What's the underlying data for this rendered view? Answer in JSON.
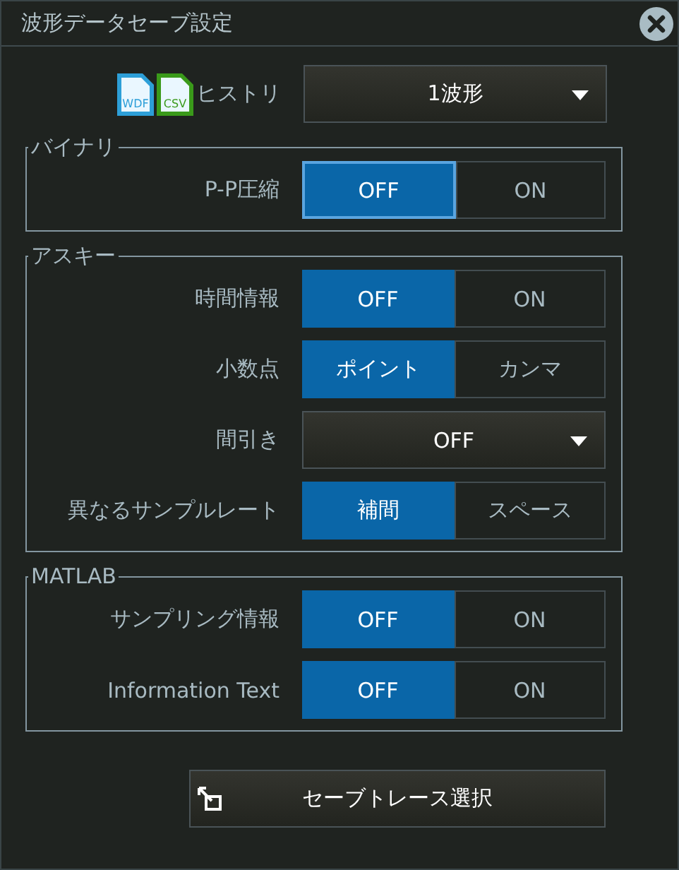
{
  "window": {
    "title": "波形データセーブ設定"
  },
  "history": {
    "file_icons": [
      {
        "text": "WDF",
        "color": "#2d9fd8"
      },
      {
        "text": "CSV",
        "color": "#3a9a1a"
      }
    ],
    "label": "ヒストリ",
    "dropdown": {
      "value": "1波形"
    }
  },
  "groups": [
    {
      "title": "バイナリ",
      "rows": [
        {
          "label": "P-P圧縮",
          "kind": "toggle",
          "options": [
            {
              "label": "OFF",
              "selected": true,
              "focused": true
            },
            {
              "label": "ON",
              "selected": false,
              "focused": false
            }
          ]
        }
      ]
    },
    {
      "title": "アスキー",
      "rows": [
        {
          "label": "時間情報",
          "kind": "toggle",
          "options": [
            {
              "label": "OFF",
              "selected": true,
              "focused": false
            },
            {
              "label": "ON",
              "selected": false,
              "focused": false
            }
          ]
        },
        {
          "label": "小数点",
          "kind": "toggle",
          "options": [
            {
              "label": "ポイント",
              "selected": true,
              "focused": false
            },
            {
              "label": "カンマ",
              "selected": false,
              "focused": false
            }
          ]
        },
        {
          "label": "間引き",
          "kind": "dropdown",
          "value": "OFF"
        },
        {
          "label": "異なるサンプルレート",
          "kind": "toggle",
          "options": [
            {
              "label": "補間",
              "selected": true,
              "focused": false
            },
            {
              "label": "スペース",
              "selected": false,
              "focused": false
            }
          ]
        }
      ]
    },
    {
      "title": "MATLAB",
      "rows": [
        {
          "label": "サンプリング情報",
          "kind": "toggle",
          "options": [
            {
              "label": "OFF",
              "selected": true,
              "focused": false
            },
            {
              "label": "ON",
              "selected": false,
              "focused": false
            }
          ]
        },
        {
          "label": "Information Text",
          "kind": "toggle",
          "options": [
            {
              "label": "OFF",
              "selected": true,
              "focused": false
            },
            {
              "label": "ON",
              "selected": false,
              "focused": false
            }
          ]
        }
      ]
    }
  ],
  "save_button": {
    "label": "セーブトレース選択"
  }
}
